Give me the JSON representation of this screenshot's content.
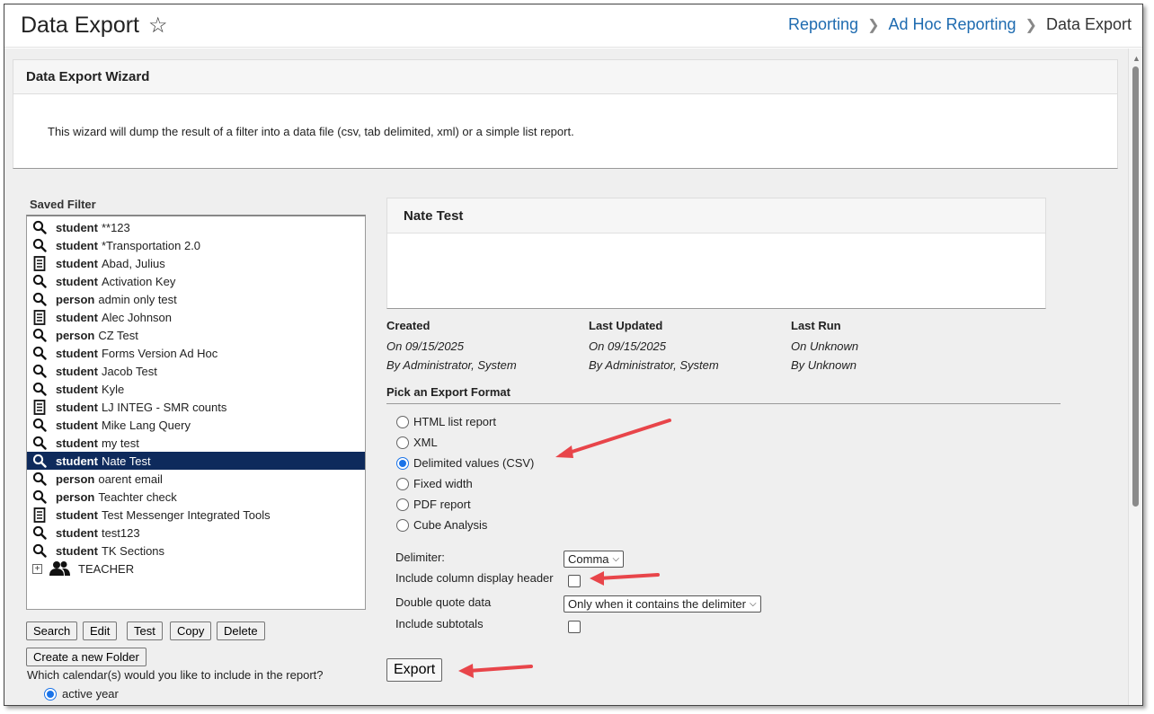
{
  "header": {
    "title": "Data Export",
    "breadcrumb": {
      "item1": "Reporting",
      "item2": "Ad Hoc Reporting",
      "current": "Data Export"
    }
  },
  "wizard": {
    "title": "Data Export Wizard",
    "description": "This wizard will dump the result of a filter into a data file (csv, tab delimited, xml) or a simple list report."
  },
  "saved_filter": {
    "label": "Saved Filter",
    "items": [
      {
        "type": "student",
        "name": "**123",
        "icon": "search-icon"
      },
      {
        "type": "student",
        "name": "*Transportation 2.0",
        "icon": "search-icon"
      },
      {
        "type": "student",
        "name": "Abad, Julius",
        "icon": "list-icon"
      },
      {
        "type": "student",
        "name": "Activation Key",
        "icon": "search-icon"
      },
      {
        "type": "person",
        "name": "admin only test",
        "icon": "search-icon"
      },
      {
        "type": "student",
        "name": "Alec Johnson",
        "icon": "list-icon"
      },
      {
        "type": "person",
        "name": "CZ Test",
        "icon": "search-icon"
      },
      {
        "type": "student",
        "name": "Forms Version Ad Hoc",
        "icon": "search-icon"
      },
      {
        "type": "student",
        "name": "Jacob Test",
        "icon": "search-icon"
      },
      {
        "type": "student",
        "name": "Kyle",
        "icon": "search-icon"
      },
      {
        "type": "student",
        "name": "LJ INTEG - SMR counts",
        "icon": "list-icon"
      },
      {
        "type": "student",
        "name": "Mike Lang Query",
        "icon": "search-icon"
      },
      {
        "type": "student",
        "name": "my test",
        "icon": "search-icon"
      },
      {
        "type": "student",
        "name": "Nate Test",
        "icon": "search-icon"
      },
      {
        "type": "person",
        "name": "oarent email",
        "icon": "search-icon"
      },
      {
        "type": "person",
        "name": "Teachter check",
        "icon": "search-icon"
      },
      {
        "type": "student",
        "name": "Test Messenger Integrated Tools",
        "icon": "list-icon"
      },
      {
        "type": "student",
        "name": "test123",
        "icon": "search-icon"
      },
      {
        "type": "student",
        "name": "TK Sections",
        "icon": "search-icon"
      }
    ],
    "selected_index": 13,
    "folder": {
      "name": "TEACHER",
      "expand": "+"
    }
  },
  "buttons": {
    "search": "Search",
    "edit": "Edit",
    "test": "Test",
    "copy": "Copy",
    "delete": "Delete",
    "new_folder": "Create a new Folder"
  },
  "calendar": {
    "question": "Which calendar(s) would you like to include in the report?",
    "option": "active year"
  },
  "filter_detail": {
    "name": "Nate Test",
    "created": {
      "label": "Created",
      "date": "On 09/15/2025",
      "by": "By Administrator, System"
    },
    "updated": {
      "label": "Last Updated",
      "date": "On 09/15/2025",
      "by": "By Administrator, System"
    },
    "last_run": {
      "label": "Last Run",
      "date": "On Unknown",
      "by": "By Unknown"
    }
  },
  "export_format": {
    "title": "Pick an Export Format",
    "options": [
      "HTML list report",
      "XML",
      "Delimited values (CSV)",
      "Fixed width",
      "PDF report",
      "Cube Analysis"
    ],
    "selected": "Delimited values (CSV)"
  },
  "options": {
    "delimiter_label": "Delimiter:",
    "delimiter_value": "Comma",
    "header_label": "Include column display header",
    "header_checked": false,
    "quote_label": "Double quote data",
    "quote_value": "Only when it contains the delimiter",
    "subtotals_label": "Include subtotals",
    "subtotals_checked": false
  },
  "export_button": "Export",
  "colors": {
    "link": "#1e6bb0",
    "selected_bg": "#0e2a5c",
    "arrow": "#e8454a",
    "radio": "#1a73e8"
  }
}
